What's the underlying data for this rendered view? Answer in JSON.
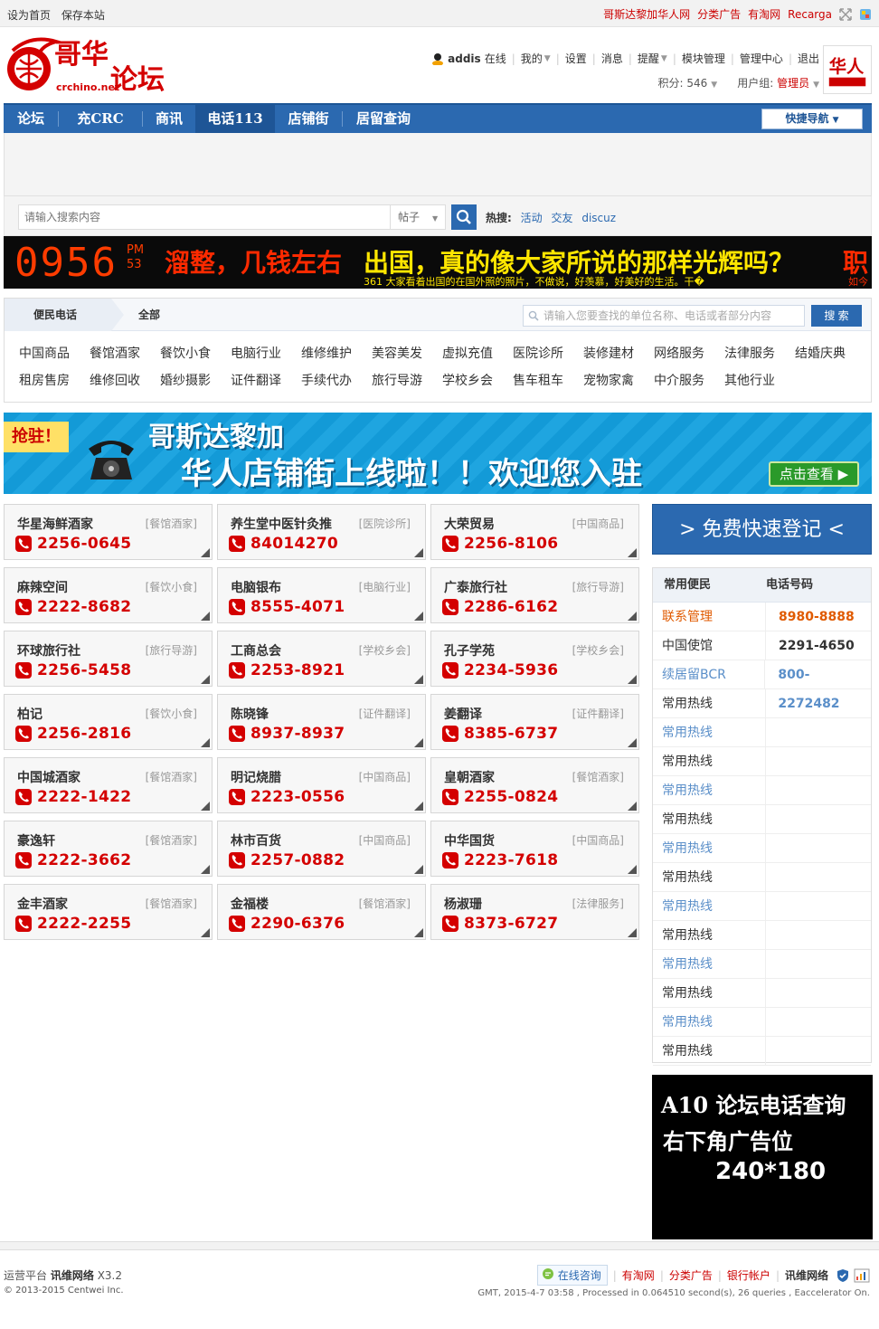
{
  "topbar": {
    "left_links": [
      "设为首页",
      "保存本站"
    ],
    "right_links": [
      "哥斯达黎加华人网",
      "分类广告",
      "有淘网",
      "Recarga"
    ]
  },
  "header": {
    "logo_text": "哥华论坛",
    "logo_domain": "crchino.net",
    "username": "addis",
    "online_text": "在线",
    "user_links": [
      "我的",
      "设置",
      "消息",
      "提醒",
      "模块管理",
      "管理中心",
      "退出"
    ],
    "points_label": "积分: 546",
    "group_label": "用户组:",
    "group_value": "管理员"
  },
  "nav": {
    "items": [
      "论坛",
      "充CRC",
      "商讯",
      "电话113",
      "店铺街",
      "居留查询"
    ],
    "active_index": 3,
    "quicknav_label": "快捷导航"
  },
  "search": {
    "placeholder": "请输入搜索内容",
    "type_label": "帖子",
    "hot_label": "热搜:",
    "hot_keywords": [
      "活动",
      "交友",
      "discuz"
    ]
  },
  "banner": {
    "time": "0956",
    "ampm_top": "PM",
    "ampm_bottom": "53",
    "text1": "溜整，几钱左右",
    "text2": "出国，真的像大家所说的那样光辉吗？",
    "text3": "361 大家看着出国的在国外照的照片，不做说，好羡慕，好美好的生活。干�",
    "text4": "职",
    "text5": "如今"
  },
  "categories": {
    "tab_label": "便民电话",
    "all_label": "全部",
    "search_placeholder": "请输入您要查找的单位名称、电话或者部分内容",
    "search_button": "搜 索",
    "items": [
      "中国商品",
      "餐馆酒家",
      "餐饮小食",
      "电脑行业",
      "维修维护",
      "美容美发",
      "虚拟充值",
      "医院诊所",
      "装修建材",
      "网络服务",
      "法律服务",
      "结婚庆典",
      "租房售房",
      "维修回收",
      "婚纱摄影",
      "证件翻译",
      "手续代办",
      "旅行导游",
      "学校乡会",
      "售车租车",
      "宠物家禽",
      "中介服务",
      "其他行业"
    ]
  },
  "promo": {
    "tag": "抢驻！",
    "line1": "哥斯达黎加",
    "line2": "华人店铺街上线啦！！欢迎您入驻",
    "cta": "点击查看"
  },
  "listings": [
    {
      "name": "华星海鲜酒家",
      "category": "[餐馆酒家]",
      "phone": "2256-0645"
    },
    {
      "name": "养生堂中医针灸推",
      "category": "[医院诊所]",
      "phone": "84014270"
    },
    {
      "name": "大荣贸易",
      "category": "[中国商品]",
      "phone": "2256-8106"
    },
    {
      "name": "麻辣空间",
      "category": "[餐饮小食]",
      "phone": "2222-8682"
    },
    {
      "name": "电脑银布",
      "category": "[电脑行业]",
      "phone": "8555-4071"
    },
    {
      "name": "广泰旅行社",
      "category": "[旅行导游]",
      "phone": "2286-6162"
    },
    {
      "name": "环球旅行社",
      "category": "[旅行导游]",
      "phone": "2256-5458"
    },
    {
      "name": "工商总会",
      "category": "[学校乡会]",
      "phone": "2253-8921"
    },
    {
      "name": "孔子学苑",
      "category": "[学校乡会]",
      "phone": "2234-5936"
    },
    {
      "name": "柏记",
      "category": "[餐饮小食]",
      "phone": "2256-2816"
    },
    {
      "name": "陈晓锋",
      "category": "[证件翻译]",
      "phone": "8937-8937"
    },
    {
      "name": "姜翻译",
      "category": "[证件翻译]",
      "phone": "8385-6737"
    },
    {
      "name": "中国城酒家",
      "category": "[餐馆酒家]",
      "phone": "2222-1422"
    },
    {
      "name": "明记烧腊",
      "category": "[中国商品]",
      "phone": "2223-0556"
    },
    {
      "name": "皇朝酒家",
      "category": "[餐馆酒家]",
      "phone": "2255-0824"
    },
    {
      "name": "豪逸轩",
      "category": "[餐馆酒家]",
      "phone": "2222-3662"
    },
    {
      "name": "林市百货",
      "category": "[中国商品]",
      "phone": "2257-0882"
    },
    {
      "name": "中华国货",
      "category": "[中国商品]",
      "phone": "2223-7618"
    },
    {
      "name": "金丰酒家",
      "category": "[餐馆酒家]",
      "phone": "2222-2255"
    },
    {
      "name": "金福楼",
      "category": "[餐馆酒家]",
      "phone": "2290-6376"
    },
    {
      "name": "杨淑珊",
      "category": "[法律服务]",
      "phone": "8373-6727"
    }
  ],
  "sidebar": {
    "register_label": "> 免费快速登记 <",
    "hotline_header": [
      "常用便民",
      "电话号码"
    ],
    "hotlines": [
      {
        "name": "联系管理",
        "phone": "8980-8888",
        "name_color": "#e05a00",
        "phone_color": "#e05a00"
      },
      {
        "name": "中国使馆",
        "phone": "2291-4650",
        "name_color": "#333333",
        "phone_color": "#333333"
      },
      {
        "name": "续居留BCR",
        "phone": "800-2272482",
        "name_color": "#5b8fc9",
        "phone_color": "#5b8fc9"
      },
      {
        "name": "常用热线",
        "phone": "",
        "name_color": "#333333",
        "phone_color": "#333333"
      },
      {
        "name": "常用热线",
        "phone": "",
        "name_color": "#5b8fc9",
        "phone_color": "#5b8fc9"
      },
      {
        "name": "常用热线",
        "phone": "",
        "name_color": "#333333",
        "phone_color": "#333333"
      },
      {
        "name": "常用热线",
        "phone": "",
        "name_color": "#5b8fc9",
        "phone_color": "#5b8fc9"
      },
      {
        "name": "常用热线",
        "phone": "",
        "name_color": "#333333",
        "phone_color": "#333333"
      },
      {
        "name": "常用热线",
        "phone": "",
        "name_color": "#5b8fc9",
        "phone_color": "#5b8fc9"
      },
      {
        "name": "常用热线",
        "phone": "",
        "name_color": "#333333",
        "phone_color": "#333333"
      },
      {
        "name": "常用热线",
        "phone": "",
        "name_color": "#5b8fc9",
        "phone_color": "#5b8fc9"
      },
      {
        "name": "常用热线",
        "phone": "",
        "name_color": "#333333",
        "phone_color": "#333333"
      },
      {
        "name": "常用热线",
        "phone": "",
        "name_color": "#5b8fc9",
        "phone_color": "#5b8fc9"
      },
      {
        "name": "常用热线",
        "phone": "",
        "name_color": "#333333",
        "phone_color": "#333333"
      },
      {
        "name": "常用热线",
        "phone": "",
        "name_color": "#5b8fc9",
        "phone_color": "#5b8fc9"
      },
      {
        "name": "常用热线",
        "phone": "",
        "name_color": "#333333",
        "phone_color": "#333333"
      }
    ],
    "ad_line1": "A10 论坛电话查询",
    "ad_line2": "右下角广告位",
    "ad_line3": "240*180"
  },
  "footer": {
    "platform_label": "运营平台",
    "platform_name": "讯维网络",
    "version": "X3.2",
    "copyright": "© 2013-2015 Centwei Inc.",
    "consult_label": "在线咨询",
    "links": [
      "有淘网",
      "分类广告",
      "银行帐户"
    ],
    "brand": "讯维网络",
    "stats": "GMT, 2015-4-7 03:58 , Processed in 0.064510 second(s), 26 queries , Eaccelerator On."
  },
  "colors": {
    "brand_blue": "#2b69b0",
    "phone_red": "#d40000",
    "link_red": "#cc0000"
  }
}
